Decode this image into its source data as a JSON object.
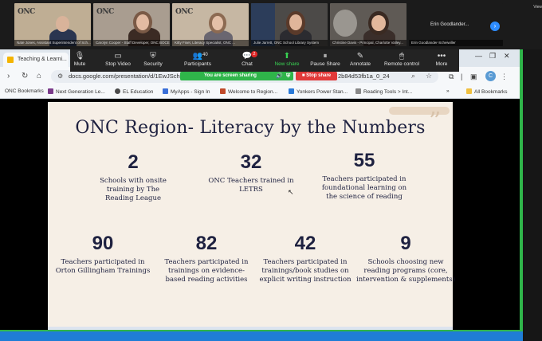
{
  "participants": [
    {
      "name": "Nate Jones, Assistant Superintendent of Sch...",
      "logo": "ONC",
      "bg": "#bfae94"
    },
    {
      "name": "Carolyn Cooper - Staff Developer, ONC BOCES",
      "logo": "ONC",
      "bg": "#a99d90"
    },
    {
      "name": "Kitty Fiset, Literacy Specialist, ONC ...",
      "logo": "ONC",
      "bg": "#c6b7a3"
    },
    {
      "name": "Julie Jarrett, ONC School Library System",
      "logo": "",
      "bg": "#4c4a48"
    },
    {
      "name": "Christine Davis - Principal, Charlotte Valley...",
      "logo": "",
      "bg": "#5f5a55"
    },
    {
      "name": "Erin Goodlander-Scheiwiller",
      "logo": "",
      "bg": "#1b1b1b"
    }
  ],
  "erin_display": "Erin Goodlander...",
  "view_label": "View",
  "toolbar": {
    "mute": "Mute",
    "stop_video": "Stop Video",
    "security": "Security",
    "participants": "Participants",
    "participants_count": "40",
    "chat": "Chat",
    "chat_badge": "2",
    "new_share": "New share",
    "pause_share": "Pause Share",
    "annotate": "Annotate",
    "remote_control": "Remote control",
    "more": "More",
    "sharing_status": "You are screen sharing",
    "stop_share": "Stop share"
  },
  "browser": {
    "tab_title": "Teaching & Learni...",
    "url_left": "docs.google.com/presentation/d/1EwJSch",
    "url_right": "2b84d53fb1a_0_24",
    "avatar_letter": "C",
    "bookmarks": [
      "ONC Bookmarks",
      "Next Generation Le...",
      "EL Education",
      "MyApps - Sign In",
      "Welcome to Region...",
      "Yonkers Power Stan...",
      "Reading Tools > Int..."
    ],
    "bookmarks_more": "»",
    "all_bookmarks": "All Bookmarks"
  },
  "slide": {
    "title": "ONC Region- Literacy by the Numbers",
    "stats": [
      {
        "number": "2",
        "label": "Schools with onsite training by The Reading League"
      },
      {
        "number": "32",
        "label": "ONC Teachers trained in LETRS"
      },
      {
        "number": "55",
        "label": "Teachers participated in foundational learning on the science of reading"
      },
      {
        "number": "90",
        "label": "Teachers participated in Orton Gillingham Trainings"
      },
      {
        "number": "82",
        "label": "Teachers participated in trainings on evidence-based reading activities"
      },
      {
        "number": "42",
        "label": "Teachers participated in trainings/book studies on explicit writing instruction"
      },
      {
        "number": "9",
        "label": "Schools choosing new reading programs (core, intervention & supplements)"
      }
    ]
  },
  "colors": {
    "slide_bg": "#f6efe6",
    "title_navy": "#1e2140",
    "share_green": "#2fb54a",
    "stop_red": "#e23a3a",
    "zoom_blue": "#1f7dd6"
  }
}
